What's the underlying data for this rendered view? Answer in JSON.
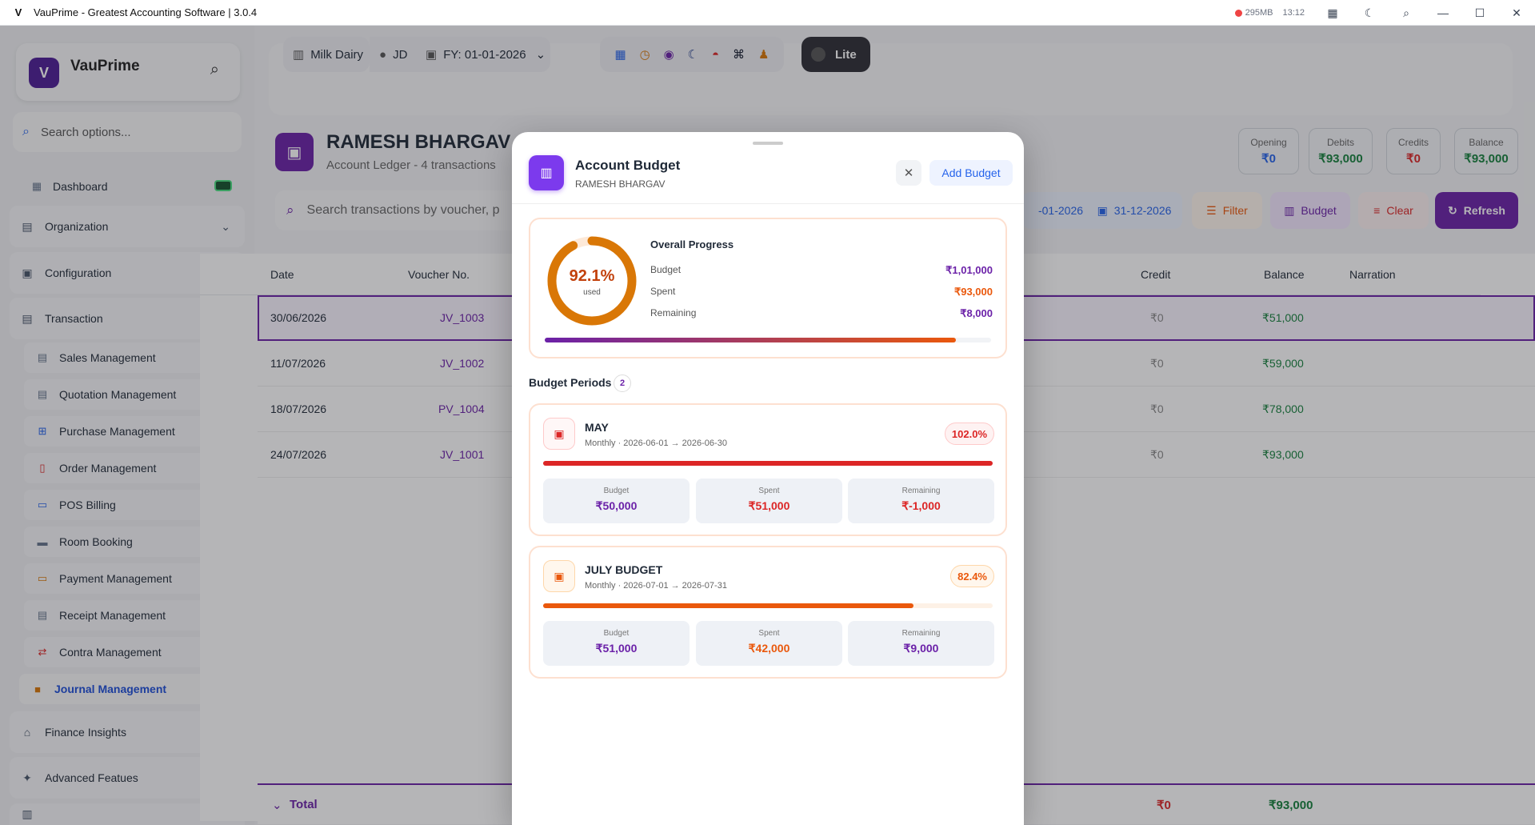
{
  "app": {
    "title": "VauPrime - Greatest Accounting Software |  3.0.4",
    "memory": "295MB",
    "time": "13:12"
  },
  "sidebar": {
    "brand_name": "VauPrime",
    "search_placeholder": "Search options...",
    "dashboard": "Dashboard",
    "sections": [
      "Organization",
      "Configuration",
      "Transaction"
    ],
    "transaction_items": [
      "Sales Management",
      "Quotation Management",
      "Purchase Management",
      "Order Management",
      "POS Billing",
      "Room Booking",
      "Payment Management",
      "Receipt Management",
      "Contra Management",
      "Journal Management"
    ],
    "bottom_sections": [
      "Finance Insights",
      "Advanced Featues"
    ]
  },
  "topbar": {
    "company": "Milk Dairy",
    "user": "JD",
    "fy": "FY: 01-01-2026",
    "lite": "Lite"
  },
  "account": {
    "name": "RAMESH BHARGAV",
    "subtitle": "Account Ledger - 4 transactions",
    "stats": [
      {
        "label": "Opening",
        "value": "₹0"
      },
      {
        "label": "Debits",
        "value": "₹93,000"
      },
      {
        "label": "Credits",
        "value": "₹0"
      },
      {
        "label": "Balance",
        "value": "₹93,000"
      }
    ],
    "search_placeholder": "Search transactions by voucher, p",
    "date_from": "-01-2026",
    "date_to": "31-12-2026",
    "buttons": {
      "filter": "Filter",
      "budget": "Budget",
      "clear": "Clear",
      "refresh": "Refresh"
    }
  },
  "table": {
    "headers": {
      "date": "Date",
      "voucher": "Voucher No.",
      "credit": "Credit",
      "balance": "Balance",
      "narration": "Narration"
    },
    "rows": [
      {
        "date": "30/06/2026",
        "voucher": "JV_1003",
        "credit": "₹0",
        "balance": "₹51,000"
      },
      {
        "date": "11/07/2026",
        "voucher": "JV_1002",
        "credit": "₹0",
        "balance": "₹59,000"
      },
      {
        "date": "18/07/2026",
        "voucher": "PV_1004",
        "credit": "₹0",
        "balance": "₹78,000"
      },
      {
        "date": "24/07/2026",
        "voucher": "JV_1001",
        "credit": "₹0",
        "balance": "₹93,000"
      }
    ],
    "total_label": "Total",
    "total_credit": "₹0",
    "total_balance": "₹93,000"
  },
  "modal": {
    "title": "Account Budget",
    "subtitle": "RAMESH BHARGAV",
    "add_button": "Add Budget",
    "overall": {
      "title": "Overall Progress",
      "percent_text": "92.1%",
      "percent": 92.1,
      "used_label": "used",
      "budget_label": "Budget",
      "budget": "₹1,01,000",
      "spent_label": "Spent",
      "spent": "₹93,000",
      "remaining_label": "Remaining",
      "remaining": "₹8,000"
    },
    "periods_title": "Budget Periods",
    "periods_count": "2",
    "periods": [
      {
        "name": "MAY",
        "range": "Monthly · 2026-06-01 → 2026-06-30",
        "percent_text": "102.0%",
        "percent": 102.0,
        "budget_label": "Budget",
        "budget": "₹50,000",
        "spent_label": "Spent",
        "spent": "₹51,000",
        "remaining_label": "Remaining",
        "remaining": "₹-1,000"
      },
      {
        "name": "JULY BUDGET",
        "range": "Monthly · 2026-07-01 → 2026-07-31",
        "percent_text": "82.4%",
        "percent": 82.4,
        "budget_label": "Budget",
        "budget": "₹51,000",
        "spent_label": "Spent",
        "spent": "₹42,000",
        "remaining_label": "Remaining",
        "remaining": "₹9,000"
      }
    ]
  },
  "colors": {
    "primary": "#6b21a8",
    "orange": "#ea580c",
    "red": "#dc2626",
    "green": "#15803d"
  }
}
